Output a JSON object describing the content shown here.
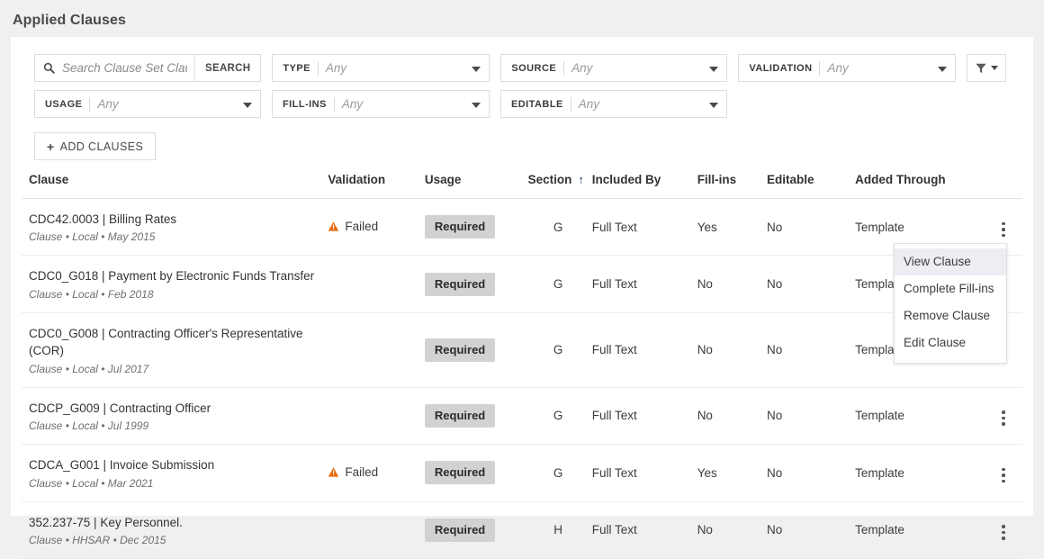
{
  "page": {
    "title": "Applied Clauses",
    "accent_sort": "#1f3864",
    "warning_color": "#e8690b",
    "badge_bg": "#d2d2d2",
    "page_bg": "#f0f0f0",
    "card_bg": "#ffffff"
  },
  "search": {
    "placeholder": "Search Clause Set Clauses",
    "value": "",
    "button_label": "SEARCH",
    "icon": "search-icon"
  },
  "filters": [
    {
      "label": "TYPE",
      "value": "Any",
      "name": "type"
    },
    {
      "label": "SOURCE",
      "value": "Any",
      "name": "source"
    },
    {
      "label": "VALIDATION",
      "value": "Any",
      "name": "validation"
    },
    {
      "label": "USAGE",
      "value": "Any",
      "name": "usage"
    },
    {
      "label": "FILL-INS",
      "value": "Any",
      "name": "fill-ins"
    },
    {
      "label": "EDITABLE",
      "value": "Any",
      "name": "editable"
    }
  ],
  "filter_button": {
    "icon": "funnel-icon"
  },
  "add_button": {
    "label": "ADD CLAUSES",
    "plus": "+"
  },
  "table": {
    "columns": [
      {
        "key": "clause",
        "label": "Clause"
      },
      {
        "key": "validation",
        "label": "Validation"
      },
      {
        "key": "usage",
        "label": "Usage"
      },
      {
        "key": "section",
        "label": "Section",
        "sorted": "asc",
        "sort_glyph": "↑"
      },
      {
        "key": "included_by",
        "label": "Included By"
      },
      {
        "key": "fill_ins",
        "label": "Fill-ins"
      },
      {
        "key": "editable",
        "label": "Editable"
      },
      {
        "key": "added_through",
        "label": "Added Through"
      }
    ],
    "rows": [
      {
        "title": "CDC42.0003 | Billing Rates",
        "meta": "Clause • Local • May 2015",
        "validation": "Failed",
        "validation_state": "failed",
        "usage": "Required",
        "section": "G",
        "included_by": "Full Text",
        "fill_ins": "Yes",
        "editable": "No",
        "added_through": "Template"
      },
      {
        "title": "CDC0_G018 | Payment by Electronic Funds Transfer",
        "meta": "Clause • Local • Feb 2018",
        "validation": "",
        "validation_state": "none",
        "usage": "Required",
        "section": "G",
        "included_by": "Full Text",
        "fill_ins": "No",
        "editable": "No",
        "added_through": "Template"
      },
      {
        "title": "CDC0_G008 | Contracting Officer's Representative (COR)",
        "meta": "Clause • Local • Jul 2017",
        "validation": "",
        "validation_state": "none",
        "usage": "Required",
        "section": "G",
        "included_by": "Full Text",
        "fill_ins": "No",
        "editable": "No",
        "added_through": "Template"
      },
      {
        "title": "CDCP_G009 | Contracting Officer",
        "meta": "Clause • Local • Jul 1999",
        "validation": "",
        "validation_state": "none",
        "usage": "Required",
        "section": "G",
        "included_by": "Full Text",
        "fill_ins": "No",
        "editable": "No",
        "added_through": "Template"
      },
      {
        "title": "CDCA_G001 | Invoice Submission",
        "meta": "Clause • Local • Mar 2021",
        "validation": "Failed",
        "validation_state": "failed",
        "usage": "Required",
        "section": "G",
        "included_by": "Full Text",
        "fill_ins": "Yes",
        "editable": "No",
        "added_through": "Template"
      },
      {
        "title": "352.237-75 | Key Personnel.",
        "meta": "Clause • HHSAR • Dec 2015",
        "validation": "",
        "validation_state": "none",
        "usage": "Required",
        "section": "H",
        "included_by": "Full Text",
        "fill_ins": "No",
        "editable": "No",
        "added_through": "Template"
      }
    ]
  },
  "context_menu": {
    "open_for_row": 1,
    "items": [
      {
        "label": "View Clause",
        "highlighted": true
      },
      {
        "label": "Complete Fill-ins",
        "highlighted": false
      },
      {
        "label": "Remove Clause",
        "highlighted": false
      },
      {
        "label": "Edit Clause",
        "highlighted": false
      }
    ]
  }
}
